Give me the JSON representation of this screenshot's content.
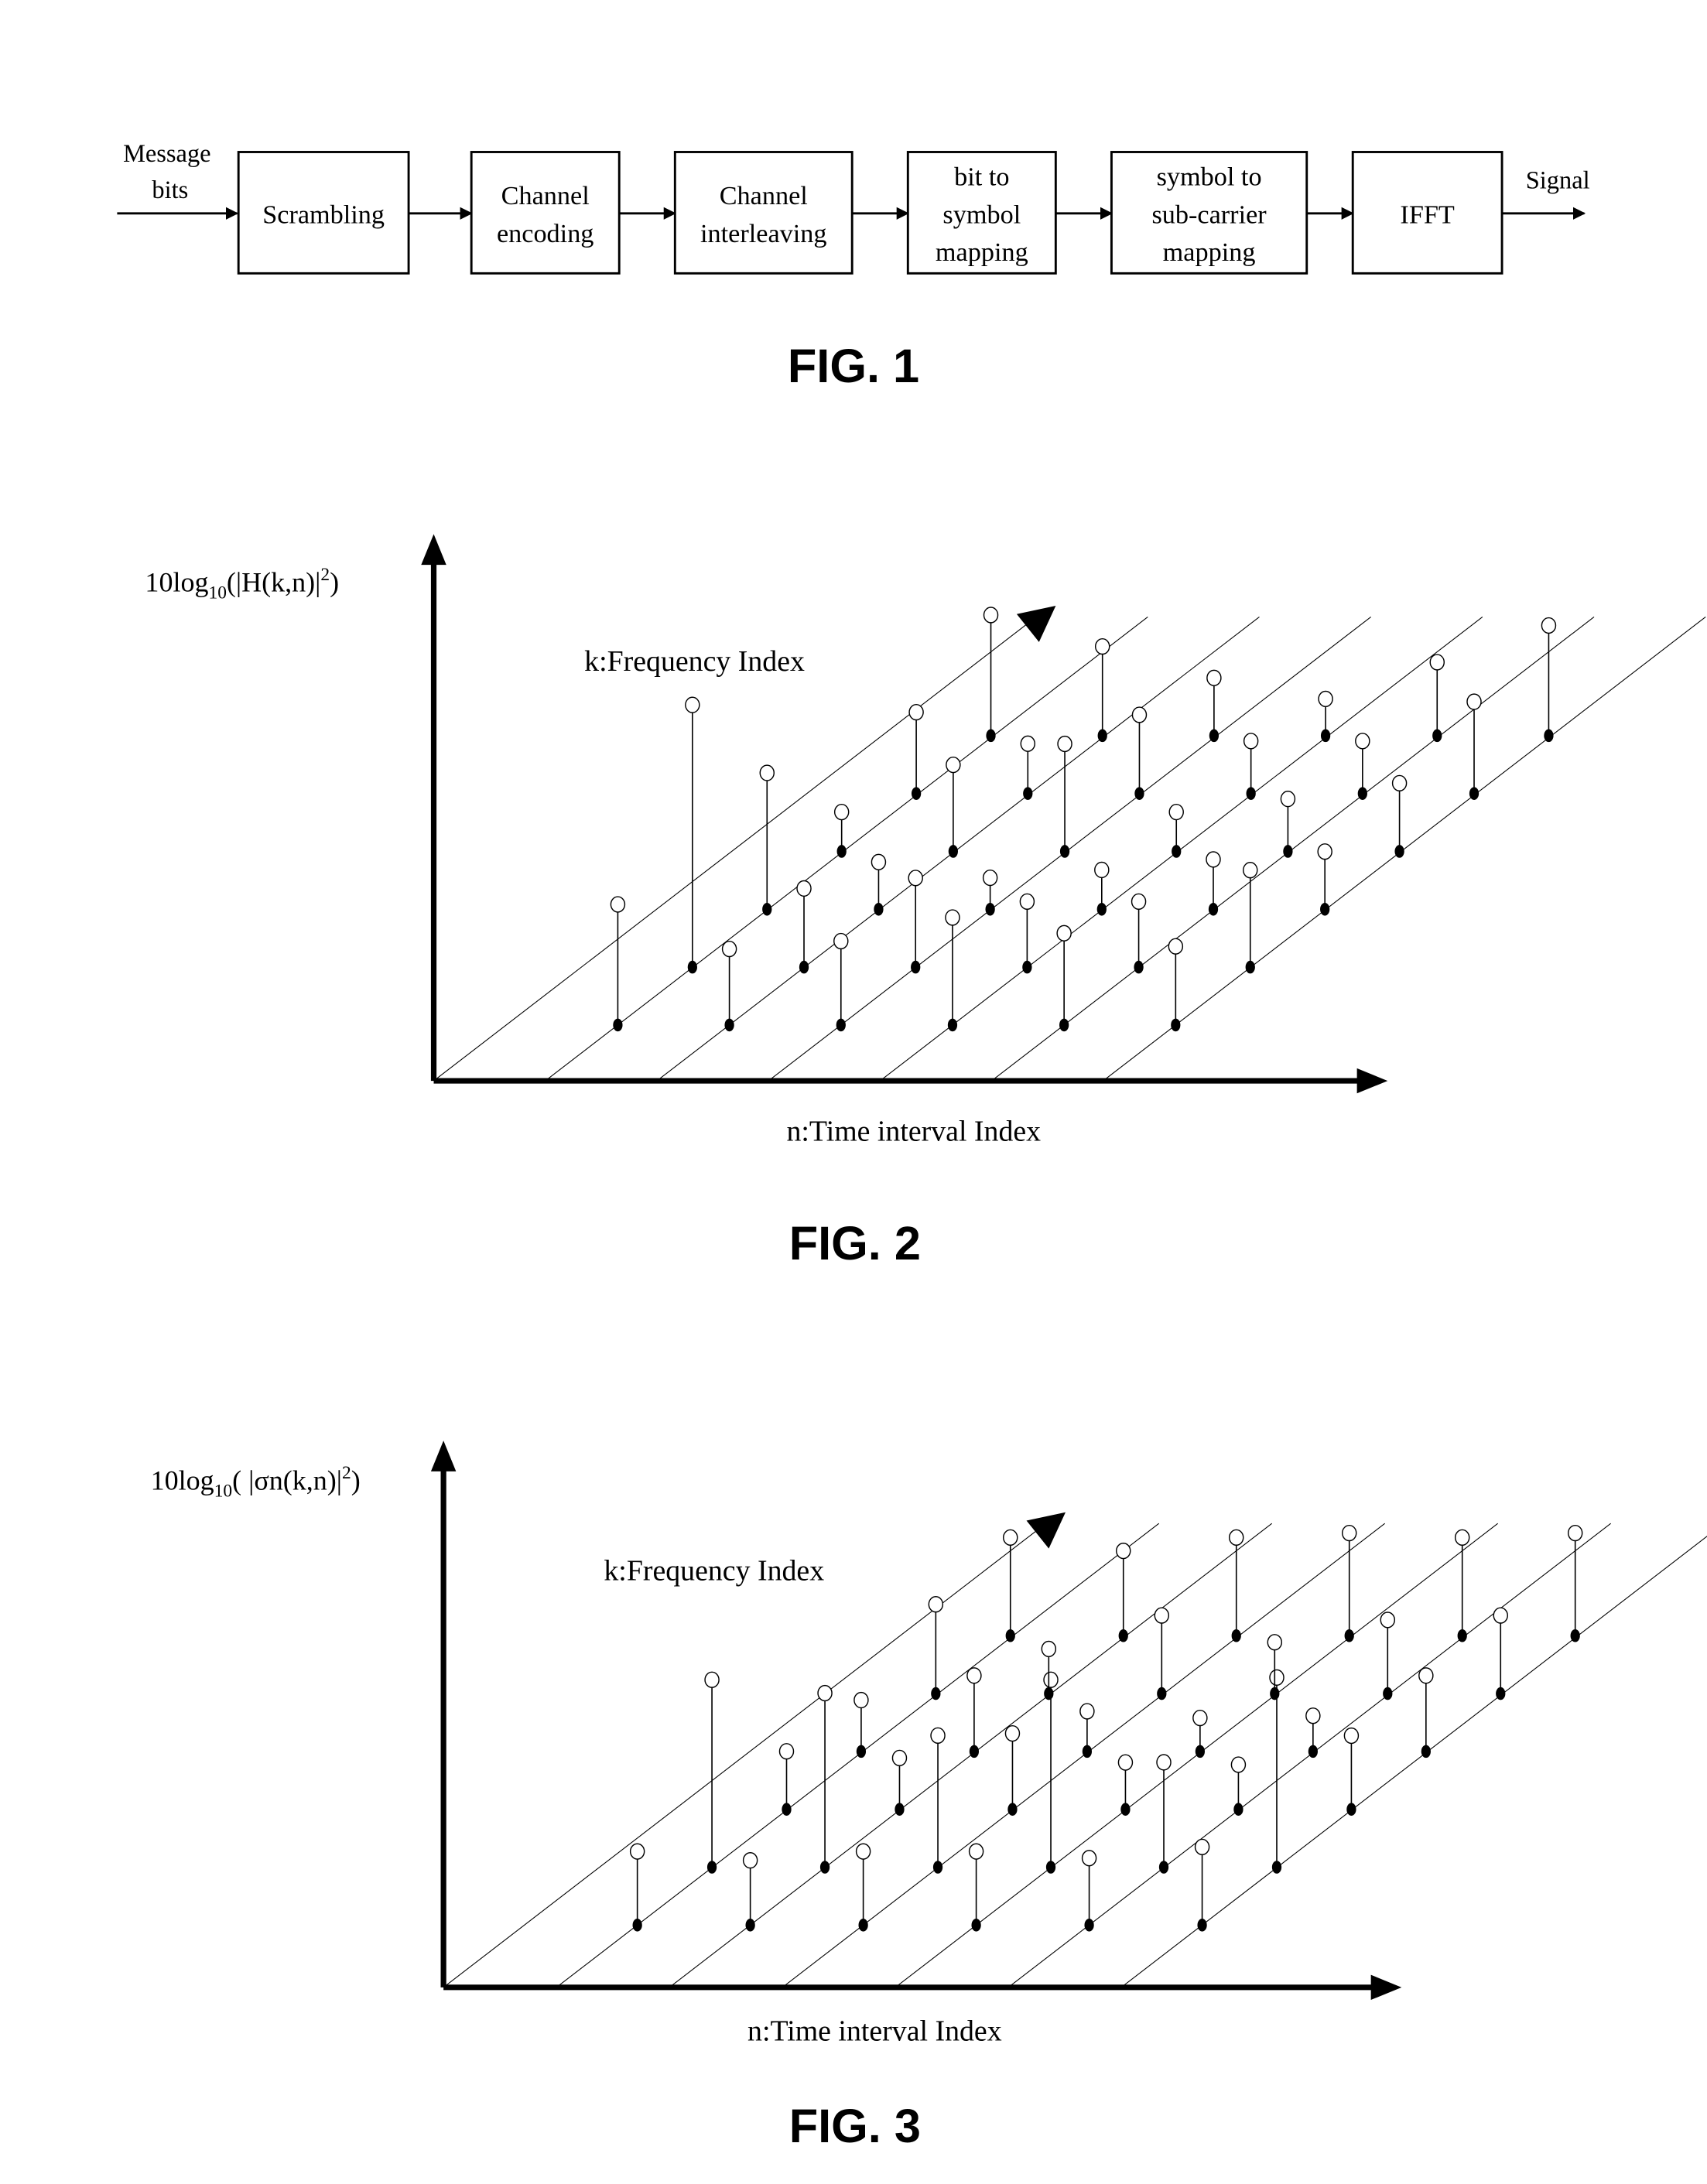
{
  "fig1": {
    "caption": "FIG. 1",
    "input_label": [
      "Message",
      "bits"
    ],
    "output_label": "Signal",
    "blocks": [
      {
        "id": "scrambling",
        "lines": [
          "Scrambling"
        ]
      },
      {
        "id": "channel-encoding",
        "lines": [
          "Channel",
          "encoding"
        ]
      },
      {
        "id": "channel-interleaving",
        "lines": [
          "Channel",
          "interleaving"
        ]
      },
      {
        "id": "bit-to-symbol-mapping",
        "lines": [
          "bit to",
          "symbol",
          "mapping"
        ]
      },
      {
        "id": "symbol-to-subcarrier-mapping",
        "lines": [
          "symbol to",
          "sub-carrier",
          "mapping"
        ]
      },
      {
        "id": "ifft",
        "lines": [
          "IFFT"
        ]
      }
    ]
  },
  "fig2": {
    "caption": "FIG. 2",
    "ylabel": {
      "prefix": "10log",
      "sub": "10",
      "body": "(|H(k,n)|",
      "sup": "2",
      "suffix": ")"
    },
    "klabel": "k:Frequency Index",
    "xlabel": "n:Time interval Index"
  },
  "fig3": {
    "caption": "FIG. 3",
    "ylabel": {
      "prefix": "10log",
      "sub": "10",
      "body": "( |σn(k,n)|",
      "sup": "2",
      "suffix": ")"
    },
    "klabel": "k:Frequency Index",
    "xlabel": "n:Time interval Index"
  },
  "chart_data": [
    {
      "type": "scatter",
      "title": "FIG. 2",
      "xlabel": "n:Time interval Index",
      "ylabel": "10log10(|H(k,n)|^2)",
      "zlabel": "k:Frequency Index",
      "n_count": 6,
      "k_count": 6,
      "note": "3D stem plot; values are relative stem heights (unitless, no axis ticks shown). Rows indexed by k (0 = front), columns by n.",
      "heights": [
        [
          0.46,
          0.29,
          0.32,
          0.41,
          0.35,
          0.3
        ],
        [
          1.0,
          0.3,
          0.34,
          0.25,
          0.25,
          0.37
        ],
        [
          0.52,
          0.18,
          0.12,
          0.15,
          0.19,
          0.22
        ],
        [
          0.15,
          0.33,
          0.41,
          0.15,
          0.2,
          0.26
        ],
        [
          0.31,
          0.19,
          0.3,
          0.2,
          0.2,
          0.35
        ],
        [
          0.46,
          0.34,
          0.22,
          0.14,
          0.28,
          0.42
        ]
      ]
    },
    {
      "type": "scatter",
      "title": "FIG. 3",
      "xlabel": "n:Time interval Index",
      "ylabel": "10log10( |σn(k,n)|^2)",
      "zlabel": "k:Frequency Index",
      "n_count": 6,
      "k_count": 6,
      "note": "3D stem plot; values are relative stem heights (unitless, no axis ticks shown). Rows indexed by k (0 = front), columns by n.",
      "heights": [
        [
          0.33,
          0.29,
          0.33,
          0.33,
          0.3,
          0.35
        ],
        [
          0.84,
          0.78,
          0.59,
          0.84,
          0.47,
          0.85
        ],
        [
          0.26,
          0.23,
          0.34,
          0.21,
          0.2,
          0.33
        ],
        [
          0.23,
          0.34,
          0.18,
          0.15,
          0.16,
          0.34
        ],
        [
          0.4,
          0.2,
          0.35,
          0.23,
          0.33,
          0.35
        ],
        [
          0.44,
          0.38,
          0.44,
          0.46,
          0.44,
          0.46
        ]
      ]
    }
  ]
}
